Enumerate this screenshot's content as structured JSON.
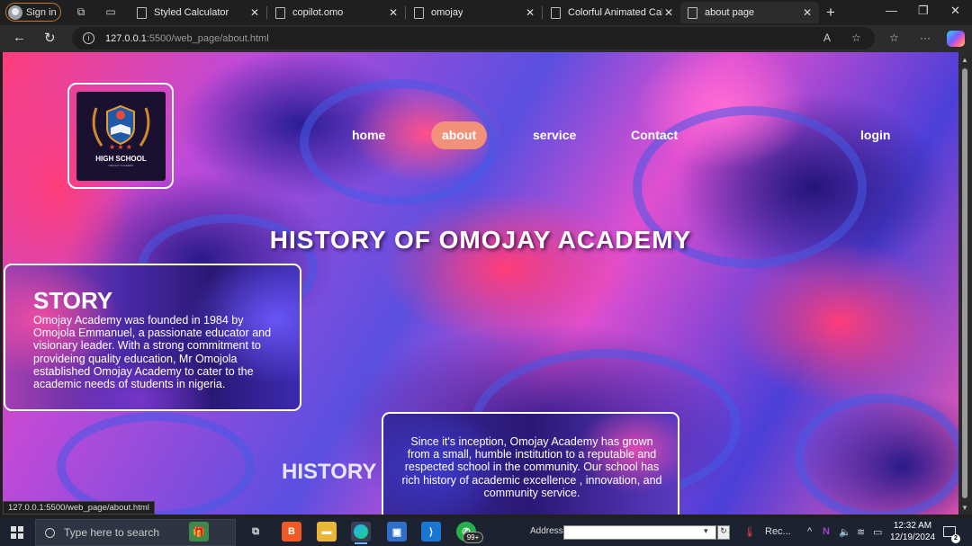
{
  "browser": {
    "signin_label": "Sign in",
    "tabs": [
      {
        "label": "Styled Calculator"
      },
      {
        "label": "copilot.omo"
      },
      {
        "label": "omojay"
      },
      {
        "label": "Colorful Animated Calcul"
      },
      {
        "label": "about page"
      }
    ],
    "url_host": "127.0.0.1",
    "url_path": ":5500/web_page/about.html",
    "status_url": "127.0.0.1:5500/web_page/about.html"
  },
  "page": {
    "logo_title": "HIGH SCHOOL",
    "logo_sub": "OMOJAY ACADEMY",
    "nav": {
      "home": "home",
      "about": "about",
      "service": "service",
      "contact": "Contact",
      "login": "login"
    },
    "title": "HISTORY OF OMOJAY ACADEMY",
    "story": {
      "heading": "STORY",
      "text": "Omojay Academy was founded in 1984 by Omojola Emmanuel, a passionate educator and visionary leader. With a strong commitment to provideing quality education, Mr Omojola established Omojay Academy to cater to the academic needs of students in nigeria."
    },
    "history": {
      "heading": "HISTORY",
      "text": "Since it's inception, Omojay Academy has grown from a small, humble institution to a reputable and respected school in the community. Our school has rich history of academic excellence , innovation, and community service."
    }
  },
  "taskbar": {
    "search_placeholder": "Type here to search",
    "whatsapp_badge": "99+",
    "address_label": "Address",
    "tray_app_label": "Rec...",
    "time": "12:32 AM",
    "date": "12/19/2024",
    "notification_count": "2"
  },
  "colors": {
    "active_nav_pill": "#f2917a",
    "chrome_bg": "#1f1f1f",
    "taskbar_bg": "#1c2230"
  }
}
